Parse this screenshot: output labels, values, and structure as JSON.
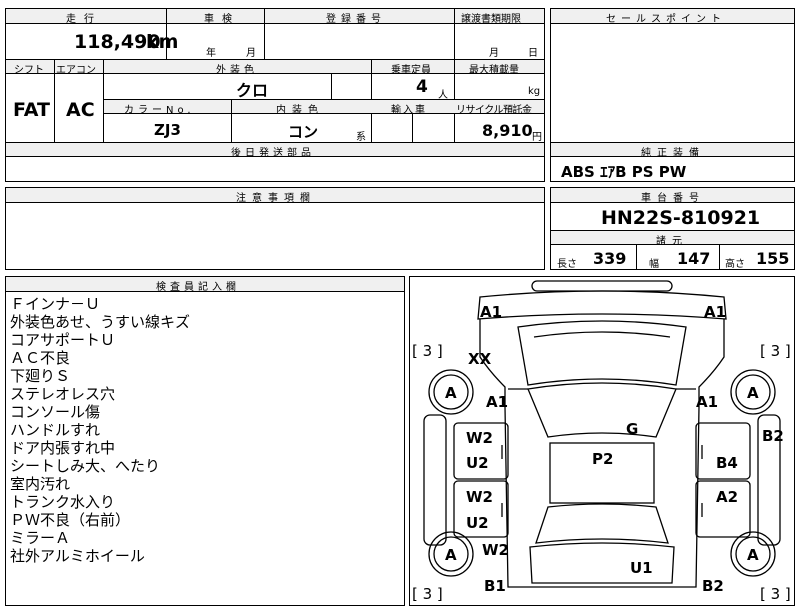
{
  "header_top": {
    "mileage_label": "走行",
    "inspection_label": "車検",
    "registration_label": "登録番号",
    "transfer_label": "譲渡書類期限",
    "sales_point_label": "セールスポイント"
  },
  "mileage": {
    "value": "118,490",
    "unit": "km"
  },
  "inspection": {
    "year_unit": "年",
    "month_unit": "月"
  },
  "transfer": {
    "month_unit": "月",
    "day_unit": "日"
  },
  "spec_labels": {
    "shift": "シフト",
    "aircon": "エアコン",
    "exterior_color": "外装色",
    "capacity": "乗車定員",
    "max_load": "最大積載量",
    "color_no": "カラーNo.",
    "interior_color": "内装色",
    "import": "輸入車",
    "recycle": "リサイクル預託金"
  },
  "spec_values": {
    "shift": "FAT",
    "aircon": "AC",
    "exterior_color": "クロ",
    "capacity": "4",
    "capacity_unit": "人",
    "load_unit": "kg",
    "color_no": "ZJ3",
    "interior_color": "コン",
    "interior_suffix": "系",
    "recycle": "8,910",
    "recycle_unit": "円"
  },
  "later_parts_label": "後日発送部品",
  "genuine_equipment": {
    "label": "純正装備",
    "value": "ABS ｴｱB PS PW"
  },
  "notes_label": "注意事項欄",
  "chassis": {
    "label": "車台番号",
    "value": "HN22S-810921"
  },
  "dimensions": {
    "label": "諸元",
    "length_label": "長さ",
    "length": "339",
    "width_label": "幅",
    "width": "147",
    "height_label": "高さ",
    "height": "155"
  },
  "inspector": {
    "label": "検査員記入欄",
    "lines": [
      "Ｆインナ－Ｕ",
      "外装色あせ、うすい線キズ",
      "コアサポートＵ",
      "ＡＣ不良",
      "下廻りＳ",
      "ステレオレス穴",
      "コンソール傷",
      "ハンドルすれ",
      "ドア内張すれ中",
      "シートしみ大、へたり",
      "室内汚れ",
      "トランク水入り",
      "ＰＷ不良（右前）",
      "ミラーＡ",
      "社外アルミホイール"
    ]
  },
  "diagram": {
    "marks": {
      "front_left": "A1",
      "front_right": "A1",
      "tire_fl_count": "[ 3 ]",
      "tire_fr_count": "[ 3 ]",
      "tire_rl_count": "[ 3 ]",
      "tire_rr_count": "[ 3 ]",
      "fender_left": "XX",
      "tire_fl": "A",
      "tire_fr": "A",
      "tire_rl": "A",
      "tire_rr": "A",
      "front_pillar_left": "A1",
      "front_pillar_right": "A1",
      "windshield": "G",
      "door_fl": "W2",
      "door_fl_2": "U2",
      "roof": "P2",
      "right_side": "B2",
      "door_fr": "B4",
      "door_rl": "W2",
      "door_rl_2": "U2",
      "door_rr": "A2",
      "quarter_left": "W2",
      "rear_left": "B1",
      "rear_center": "U1",
      "rear_right": "B2"
    }
  }
}
